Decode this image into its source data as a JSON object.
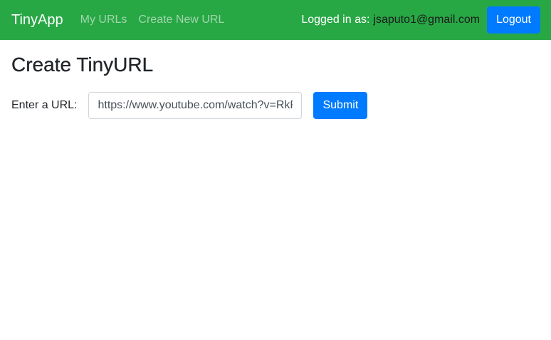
{
  "navbar": {
    "brand": "TinyApp",
    "links": [
      "My URLs",
      "Create New URL"
    ],
    "logged_in_label": "Logged in as:",
    "user_email": "jsaputo1@gmail.com",
    "logout_label": "Logout",
    "background_color": "#28a745"
  },
  "main": {
    "title": "Create TinyURL",
    "form": {
      "url_label": "Enter a URL:",
      "url_value": "https://www.youtube.com/watch?v=RkRkRkRkRk",
      "url_value_visible": "https://www.youtube.com/watch?v=Rk",
      "submit_label": "Submit"
    }
  },
  "colors": {
    "primary_button": "#007bff",
    "navbar": "#28a745"
  }
}
